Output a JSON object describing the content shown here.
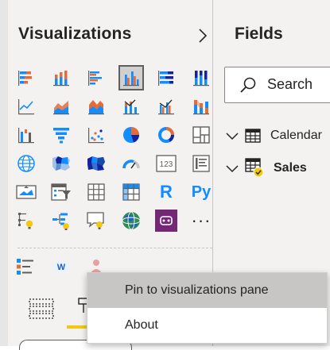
{
  "viz_pane": {
    "title": "Visualizations",
    "collapse_icon": "chevron-right-icon",
    "visuals": [
      [
        "stacked-bar-chart-icon",
        "stacked-column-chart-icon",
        "clustered-bar-chart-icon",
        "clustered-column-chart-icon",
        "100pct-stacked-bar-chart-icon",
        "100pct-stacked-column-chart-icon"
      ],
      [
        "line-chart-icon",
        "area-chart-icon",
        "stacked-area-chart-icon",
        "line-and-stacked-column-chart-icon",
        "line-and-clustered-column-chart-icon",
        "ribbon-chart-icon"
      ],
      [
        "waterfall-chart-icon",
        "funnel-chart-icon",
        "scatter-chart-icon",
        "pie-chart-icon",
        "donut-chart-icon",
        "treemap-icon"
      ],
      [
        "map-icon",
        "filled-map-icon",
        "shape-map-icon",
        "gauge-icon",
        "card-icon",
        "multi-row-card-icon"
      ],
      [
        "kpi-icon",
        "slicer-icon",
        "table-icon",
        "matrix-icon",
        "r-script-visual-icon",
        "python-visual-icon"
      ],
      [
        "key-influencers-icon",
        "decomposition-tree-icon",
        "qa-visual-icon",
        "arcgis-map-icon",
        "power-apps-icon",
        "more-options-icon"
      ]
    ],
    "selected_visual": "clustered-column-chart-icon",
    "custom_visuals": [
      "custom-list-visual-icon",
      "word-cloud-visual-icon",
      "custom-visual-person-icon"
    ]
  },
  "r_letter": "R",
  "py_letters": "Py",
  "card_number": "123",
  "more_dots": "···",
  "word_cloud_letter": "W",
  "fields_pane": {
    "title": "Fields",
    "search_placeholder": "Search",
    "tables": [
      {
        "name": "Calendar",
        "bold": false,
        "icon": "table-icon"
      },
      {
        "name": "Sales",
        "bold": true,
        "icon": "table-with-measure-icon"
      }
    ]
  },
  "bottom_tabs": {
    "fields_tab_icon": "fields-well-icon",
    "format_tab_icon": "format-paint-roller-icon",
    "active_color": "#f2c811"
  },
  "context_menu": {
    "items": [
      {
        "label": "Pin to visualizations pane",
        "highlighted": true
      },
      {
        "label": "About",
        "highlighted": false
      }
    ]
  },
  "colors": {
    "pane_bg": "#f3f2f1",
    "accent_blue": "#118dff",
    "accent_dark_blue": "#12239e",
    "accent_orange": "#e66c37",
    "menu_highlight": "#c8c6c4"
  }
}
